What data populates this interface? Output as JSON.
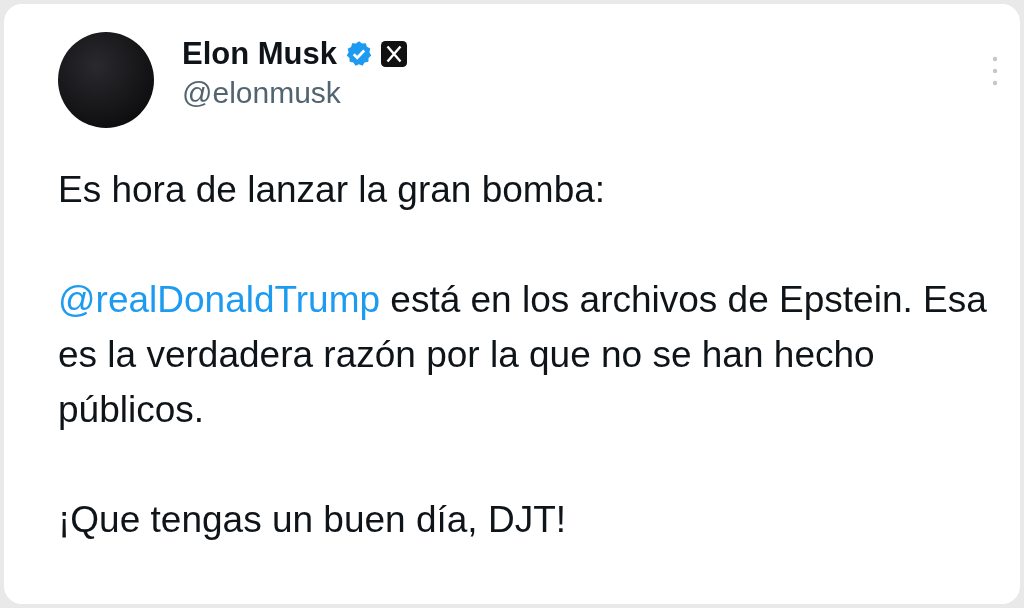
{
  "tweet": {
    "author": {
      "name": "Elon Musk",
      "handle": "@elonmusk",
      "verified": true
    },
    "paragraphs": [
      {
        "text": "Es hora de lanzar la gran bomba:"
      },
      {
        "mention": "@realDonaldTrump",
        "text": " está en los archivos de Epstein. Esa es la verdadera razón por la que no se han hecho públicos."
      },
      {
        "text": "¡Que tengas un buen día, DJT!"
      }
    ]
  }
}
